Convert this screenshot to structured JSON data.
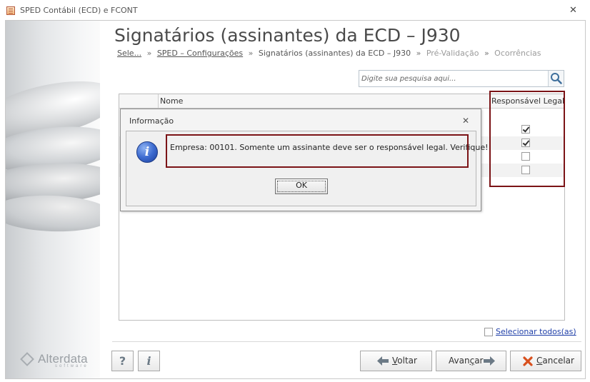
{
  "window": {
    "title": "SPED Contábil (ECD) e FCONT",
    "close_glyph": "✕",
    "app_icon": "spreadsheet-icon"
  },
  "sidebar": {
    "logo_name": "Alterdata",
    "logo_sub": "software"
  },
  "page": {
    "title": "Signatários (assinantes) da ECD – J930"
  },
  "breadcrumb": {
    "items": [
      {
        "label": "Sele...",
        "link": true
      },
      {
        "label": "SPED – Configurações",
        "link": true
      },
      {
        "label": "Signatários (assinantes) da ECD – J930",
        "current": true
      },
      {
        "label": "Pré-Validação",
        "muted": true
      },
      {
        "label": "Ocorrências",
        "muted": true
      }
    ],
    "separator": "»"
  },
  "search": {
    "placeholder": "Digite sua pesquisa aqui...",
    "icon": "search-icon"
  },
  "grid": {
    "columns": [
      "Nome",
      "Responsável Legal"
    ],
    "rows": [
      {
        "nome": "",
        "responsavel_legal": true
      },
      {
        "nome": "",
        "responsavel_legal": true
      },
      {
        "nome": "",
        "responsavel_legal": false
      },
      {
        "nome": "",
        "responsavel_legal": false
      }
    ]
  },
  "select_all": {
    "label": "Selecionar todos(as)",
    "checked": false
  },
  "footer": {
    "help_glyph": "?",
    "info_glyph": "i",
    "back_label": "Voltar",
    "next_label": "Avançar",
    "cancel_label": "Cancelar"
  },
  "dialog": {
    "title": "Informação",
    "close_glyph": "✕",
    "icon": "info-icon",
    "icon_glyph": "i",
    "message": "Empresa: 00101. Somente um assinante deve ser o responsável legal. Verifique!",
    "ok_label": "OK"
  },
  "colors": {
    "highlight": "#7b1316",
    "link": "#1f3fa8",
    "cancel_icon": "#d8501e",
    "arrow_icon": "#6c7a86"
  }
}
